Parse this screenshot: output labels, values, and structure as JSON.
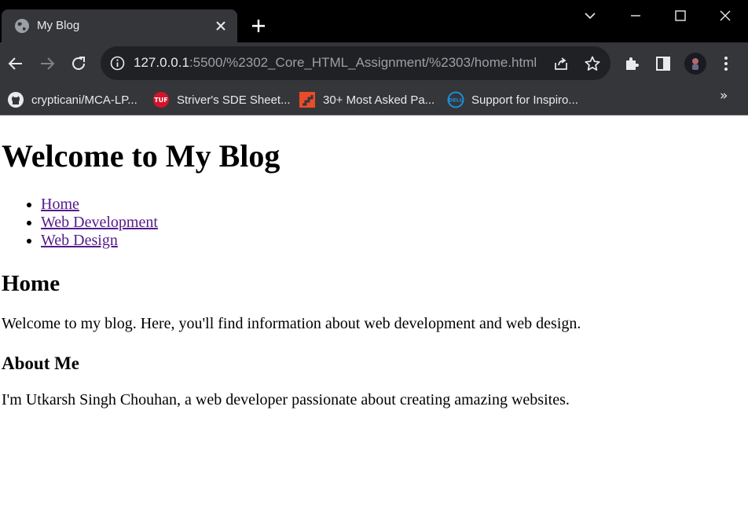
{
  "browser": {
    "tab": {
      "title": "My Blog"
    },
    "address": {
      "host": "127.0.0.1",
      "rest": ":5500/%2302_Core_HTML_Assignment/%2303/home.html"
    },
    "bookmarks": [
      {
        "label": "crypticani/MCA-LP...",
        "icon": "github-icon"
      },
      {
        "label": "Striver's SDE Sheet...",
        "icon": "tuf-icon"
      },
      {
        "label": "30+ Most Asked Pa...",
        "icon": "leetcode-icon"
      },
      {
        "label": "Support for Inspiro...",
        "icon": "dell-icon"
      }
    ],
    "bookmarks_overflow": "»",
    "colors": {
      "titlebar": "#000000",
      "toolbar": "#35363a",
      "omnibox": "#202124",
      "text": "#e8eaed",
      "muted": "#9aa0a6"
    }
  },
  "page": {
    "heading": "Welcome to My Blog",
    "nav": [
      {
        "label": "Home"
      },
      {
        "label": "Web Development"
      },
      {
        "label": "Web Design"
      }
    ],
    "section_title": "Home",
    "intro": "Welcome to my blog. Here, you'll find information about web development and web design.",
    "about_title": "About Me",
    "about_text": "I'm Utkarsh Singh Chouhan, a web developer passionate about creating amazing websites.",
    "link_color": "#551a8b"
  }
}
